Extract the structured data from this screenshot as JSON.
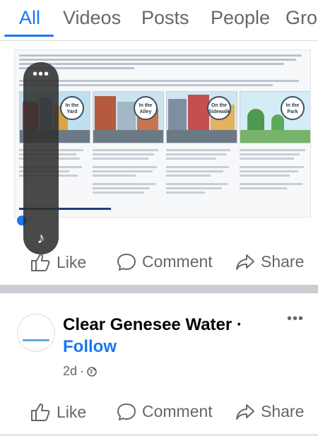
{
  "tabs": [
    {
      "label": "All",
      "active": true
    },
    {
      "label": "Videos",
      "active": false
    },
    {
      "label": "Posts",
      "active": false
    },
    {
      "label": "People",
      "active": false
    },
    {
      "label": "Gro",
      "active": false
    }
  ],
  "post1": {
    "image": {
      "panels": [
        {
          "badge": "In the Yard"
        },
        {
          "badge": "In the Alley"
        },
        {
          "badge": "On the Sidewalk"
        },
        {
          "badge": "In the Park"
        }
      ]
    },
    "actions": {
      "like": "Like",
      "comment": "Comment",
      "share": "Share"
    }
  },
  "post2": {
    "page_name": "Clear Genesee Water ·",
    "follow": "Follow",
    "time": "2d",
    "dot": "·",
    "more": "•••",
    "actions": {
      "like": "Like",
      "comment": "Comment",
      "share": "Share"
    }
  },
  "overlay": {
    "more": "•••",
    "music": "♪"
  },
  "colors": {
    "accent": "#1877f2",
    "muted": "#65676b"
  }
}
